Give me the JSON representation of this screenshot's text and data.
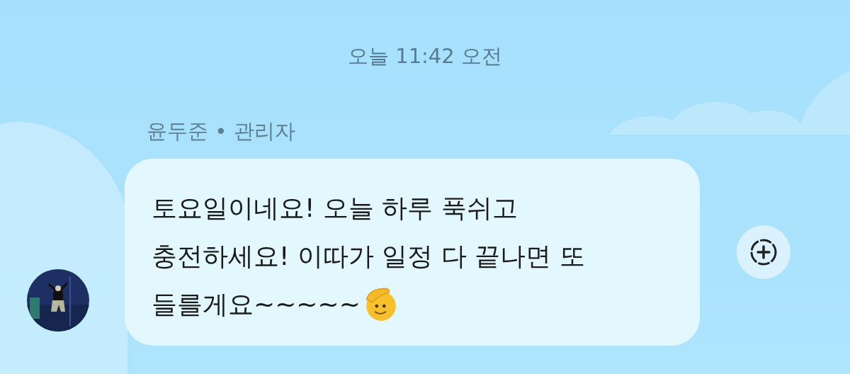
{
  "timestamp": "오늘 11:42 오전",
  "message": {
    "sender": "윤두준",
    "role": "관리자",
    "separator": "•",
    "lines": [
      "토요일이네요! 오늘 하루 푹쉬고",
      "충전하세요! 이따가 일정 다 끝나면 또",
      "들를게요~~~~~"
    ]
  }
}
